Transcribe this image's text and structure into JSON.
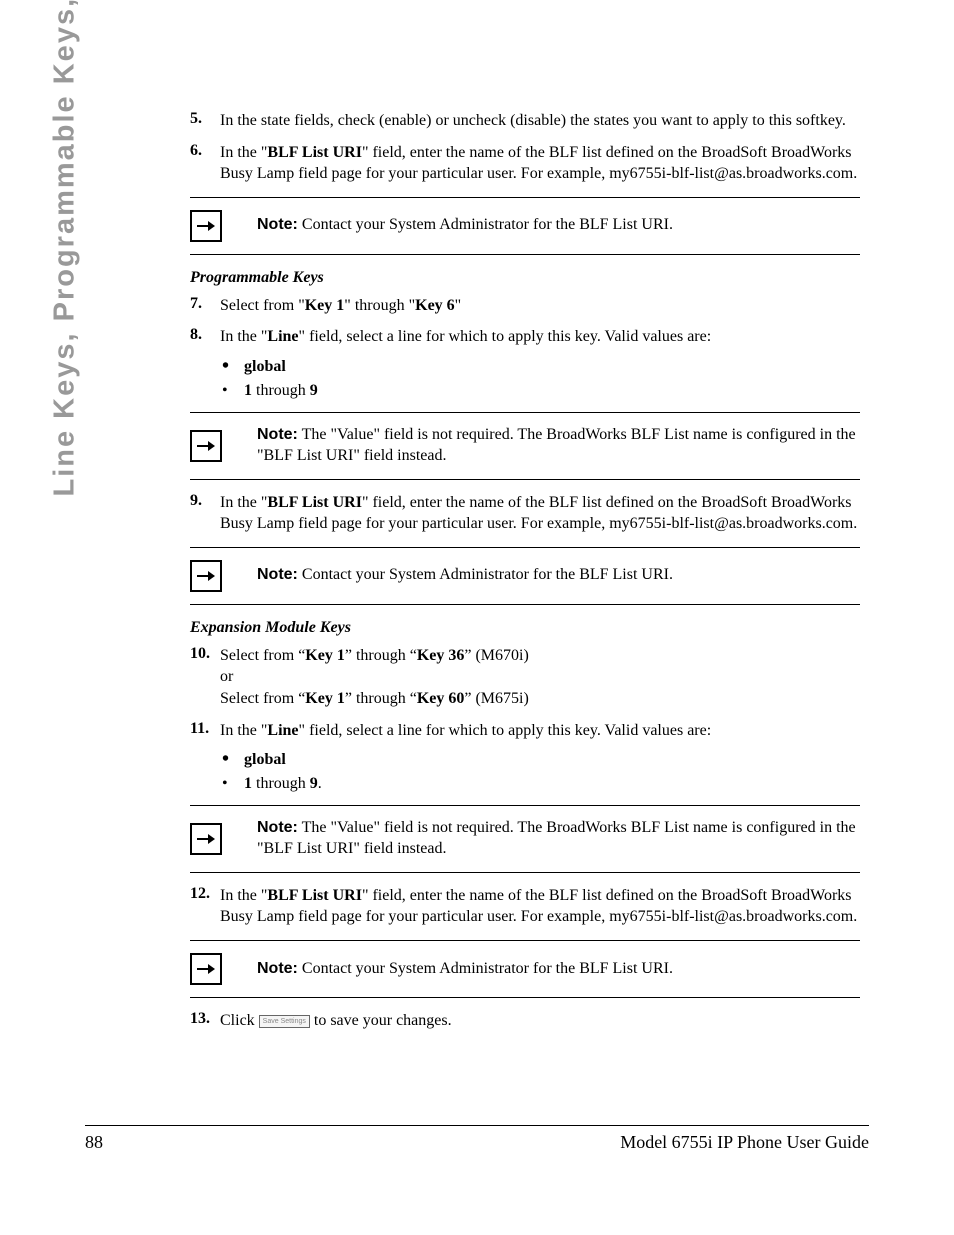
{
  "side_heading": "Line Keys, Programmable Keys, and Softkeys",
  "steps": {
    "s5_num": "5.",
    "s5": "In the state fields, check (enable) or uncheck (disable) the states you want to apply to this softkey.",
    "s6_num": "6.",
    "s6_pre": "In the \"",
    "s6_bold": "BLF List URI",
    "s6_post": "\" field, enter the name of the BLF list defined on the BroadSoft BroadWorks Busy Lamp field page for your particular user. For example, my6755i-blf-list@as.broadworks.com.",
    "s7_num": "7.",
    "s7_pre": "Select from \"",
    "s7_b1": "Key 1",
    "s7_mid": "\" through \"",
    "s7_b2": "Key 6",
    "s7_post": "\"",
    "s8_num": "8.",
    "s8_pre": "In the \"",
    "s8_bold": "Line",
    "s8_post": "\" field, select a line for which to apply this key. Valid values are:",
    "s9_num": "9.",
    "s9_pre": "In the \"",
    "s9_bold": "BLF List URI",
    "s9_post": "\" field, enter the name of the BLF list defined on the BroadSoft BroadWorks Busy Lamp field page for your particular user. For example, my6755i-blf-list@as.broadworks.com.",
    "s10_num": "10.",
    "s10_l1_pre": "Select from “",
    "s10_l1_b1": "Key 1",
    "s10_l1_mid": "” through “",
    "s10_l1_b2": "Key 36",
    "s10_l1_post": "” (M670i)",
    "s10_or": "or",
    "s10_l2_pre": "Select from “",
    "s10_l2_b1": "Key 1",
    "s10_l2_mid": "” through “",
    "s10_l2_b2": "Key 60",
    "s10_l2_post": "” (M675i)",
    "s11_num": "11.",
    "s11_pre": "In the \"",
    "s11_bold": "Line",
    "s11_post": "\" field, select a line for which to apply this key. Valid values are:",
    "s12_num": "12.",
    "s12_pre": "In the \"",
    "s12_bold": "BLF List URI",
    "s12_post": "\" field, enter the name of the BLF list defined on the BroadSoft BroadWorks Busy Lamp field page for your particular user. For example, my6755i-blf-list@as.broadworks.com.",
    "s13_num": "13.",
    "s13_pre": "Click ",
    "s13_btn": "Save Settings",
    "s13_post": " to save your changes."
  },
  "bullets": {
    "global": "global",
    "range_pre": "1",
    "range_mid": " through ",
    "range_post": "9",
    "range_period": "."
  },
  "headings": {
    "prog": "Programmable Keys",
    "exp": "Expansion Module Keys"
  },
  "notes": {
    "label": "Note:",
    "contact": " Contact your System Administrator for the BLF List URI.",
    "value": " The \"Value\" field is not required. The BroadWorks BLF List name is configured in the \"BLF List URI\" field instead."
  },
  "footer": {
    "page": "88",
    "title": "Model 6755i IP Phone User Guide"
  }
}
